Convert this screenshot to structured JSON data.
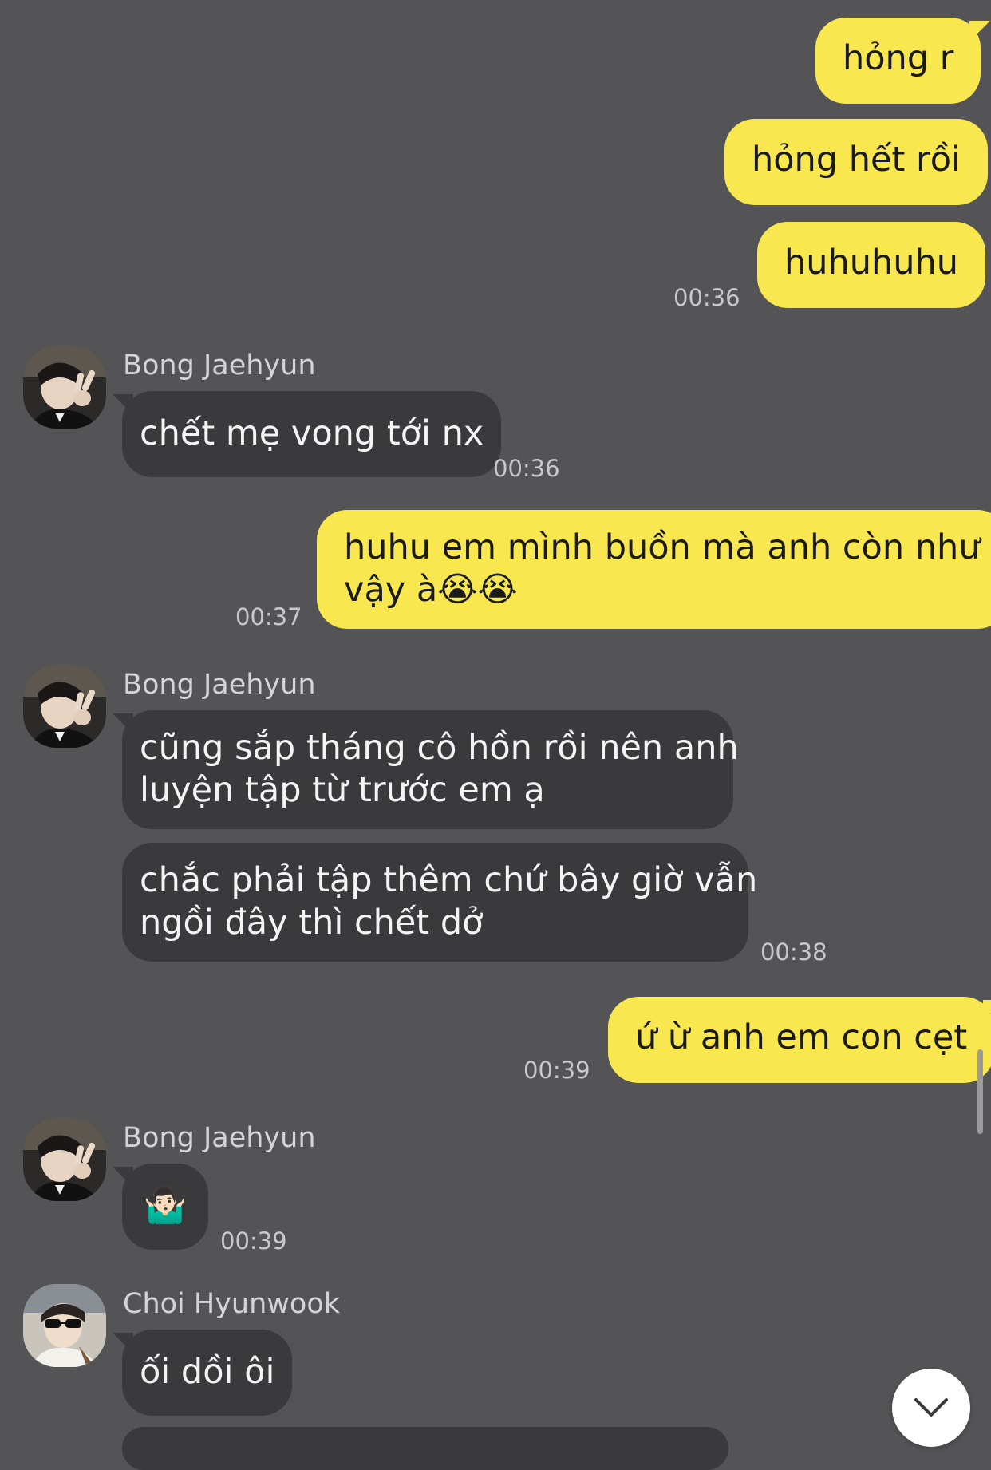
{
  "colors": {
    "background": "#545456",
    "outgoing_bubble": "#f8e74e",
    "incoming_bubble": "#3a3a3c",
    "timestamp": "#c8c8ca"
  },
  "messages": [
    {
      "text": "hỏng r"
    },
    {
      "text": "hỏng hết rồi"
    },
    {
      "text": "huhuhuhu",
      "time": "00:36"
    },
    {
      "sender": "Bong Jaehyun",
      "text": "chết mẹ vong tới nx",
      "time": "00:36"
    },
    {
      "line1": "huhu em mình buồn mà anh còn như",
      "line2": "vậy à😭😭",
      "time": "00:37"
    },
    {
      "sender": "Bong Jaehyun",
      "line1": "cũng sắp tháng cô hồn rồi nên anh",
      "line2": "luyện tập từ trước em ạ"
    },
    {
      "line1": "chắc phải tập thêm chứ bây giờ vẫn",
      "line2": "ngồi đây thì chết dở",
      "time": "00:38"
    },
    {
      "text": "ứ ừ anh em con cẹt",
      "time": "00:39"
    },
    {
      "sender": "Bong Jaehyun",
      "text": "🤷🏻‍♂️",
      "time": "00:39"
    },
    {
      "sender": "Choi Hyunwook",
      "text": "ối dồi ôi"
    }
  ],
  "icons": {
    "avatar_bong": "avatar-photo-peace-sign",
    "avatar_choi": "avatar-photo-sunglasses",
    "scroll_down": "chevron-down-icon"
  }
}
